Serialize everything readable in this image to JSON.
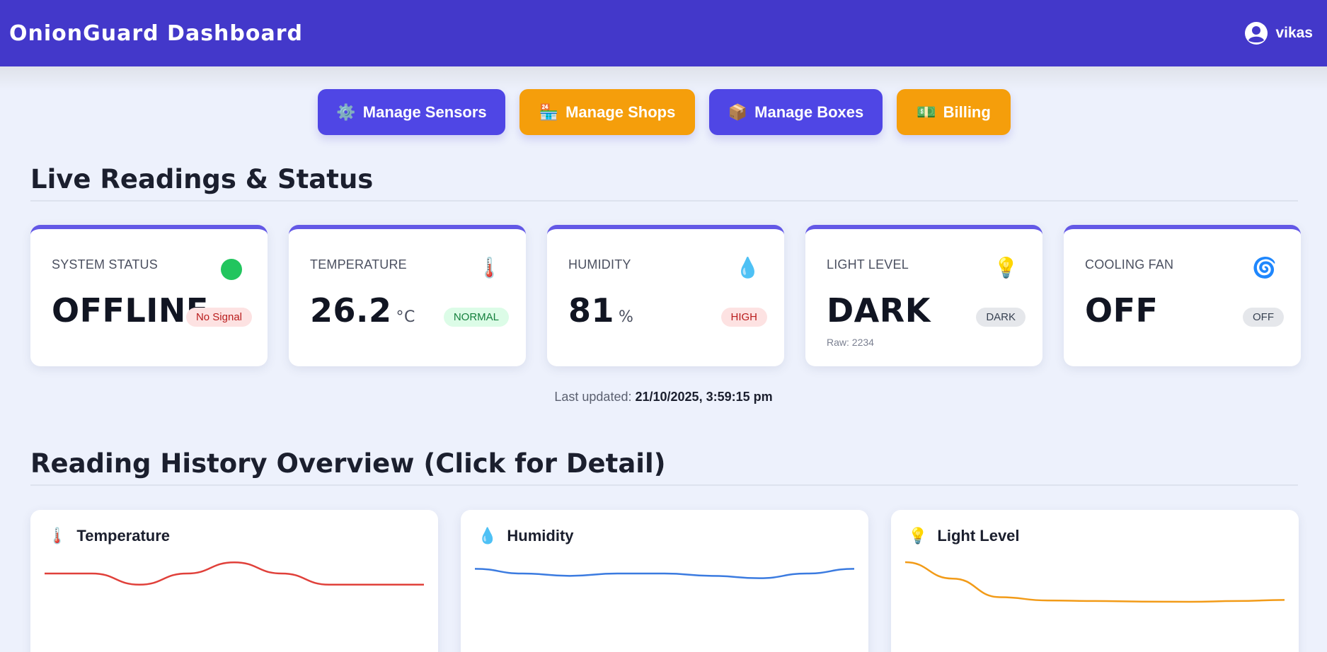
{
  "header": {
    "title": "OnionGuard Dashboard",
    "username": "vikas"
  },
  "actions": [
    {
      "label": "Manage Sensors",
      "icon": "⚙️"
    },
    {
      "label": "Manage Shops",
      "icon": "🏪"
    },
    {
      "label": "Manage Boxes",
      "icon": "📦"
    },
    {
      "label": "Billing",
      "icon": "💵"
    }
  ],
  "live": {
    "title": "Live Readings & Status",
    "cards": [
      {
        "label": "SYSTEM STATUS",
        "value": "OFFLINE",
        "unit": "",
        "badge": "No Signal",
        "icon": "status-dot"
      },
      {
        "label": "TEMPERATURE",
        "value": "26.2",
        "unit": "°C",
        "badge": "NORMAL",
        "icon": "🌡️"
      },
      {
        "label": "HUMIDITY",
        "value": "81",
        "unit": "%",
        "badge": "HIGH",
        "icon": "💧"
      },
      {
        "label": "LIGHT LEVEL",
        "value": "DARK",
        "unit": "",
        "badge": "DARK",
        "raw": "Raw: 2234",
        "icon": "💡"
      },
      {
        "label": "COOLING FAN",
        "value": "OFF",
        "unit": "",
        "badge": "OFF",
        "icon": "🌀"
      }
    ],
    "last_updated_label": "Last updated:",
    "last_updated_value": "21/10/2025, 3:59:15 pm"
  },
  "history": {
    "title": "Reading History Overview (Click for Detail)",
    "charts": [
      {
        "label": "Temperature",
        "icon": "🌡️",
        "color": "#e0403a"
      },
      {
        "label": "Humidity",
        "icon": "💧",
        "color": "#3b7be0"
      },
      {
        "label": "Light Level",
        "icon": "💡",
        "color": "#f29b18"
      }
    ]
  },
  "chart_data": [
    {
      "type": "line",
      "title": "Temperature",
      "values": [
        26.3,
        26.3,
        26.2,
        26.3,
        26.4,
        26.3,
        26.2,
        26.2,
        26.2
      ],
      "color": "#e0403a"
    },
    {
      "type": "line",
      "title": "Humidity",
      "values": [
        81.2,
        81.0,
        80.9,
        81.0,
        81.0,
        80.9,
        80.8,
        81.0,
        81.2
      ],
      "color": "#3b7be0"
    },
    {
      "type": "line",
      "title": "Light Level",
      "values": [
        2600,
        2450,
        2280,
        2250,
        2245,
        2240,
        2238,
        2245,
        2255
      ],
      "color": "#f29b18"
    }
  ]
}
